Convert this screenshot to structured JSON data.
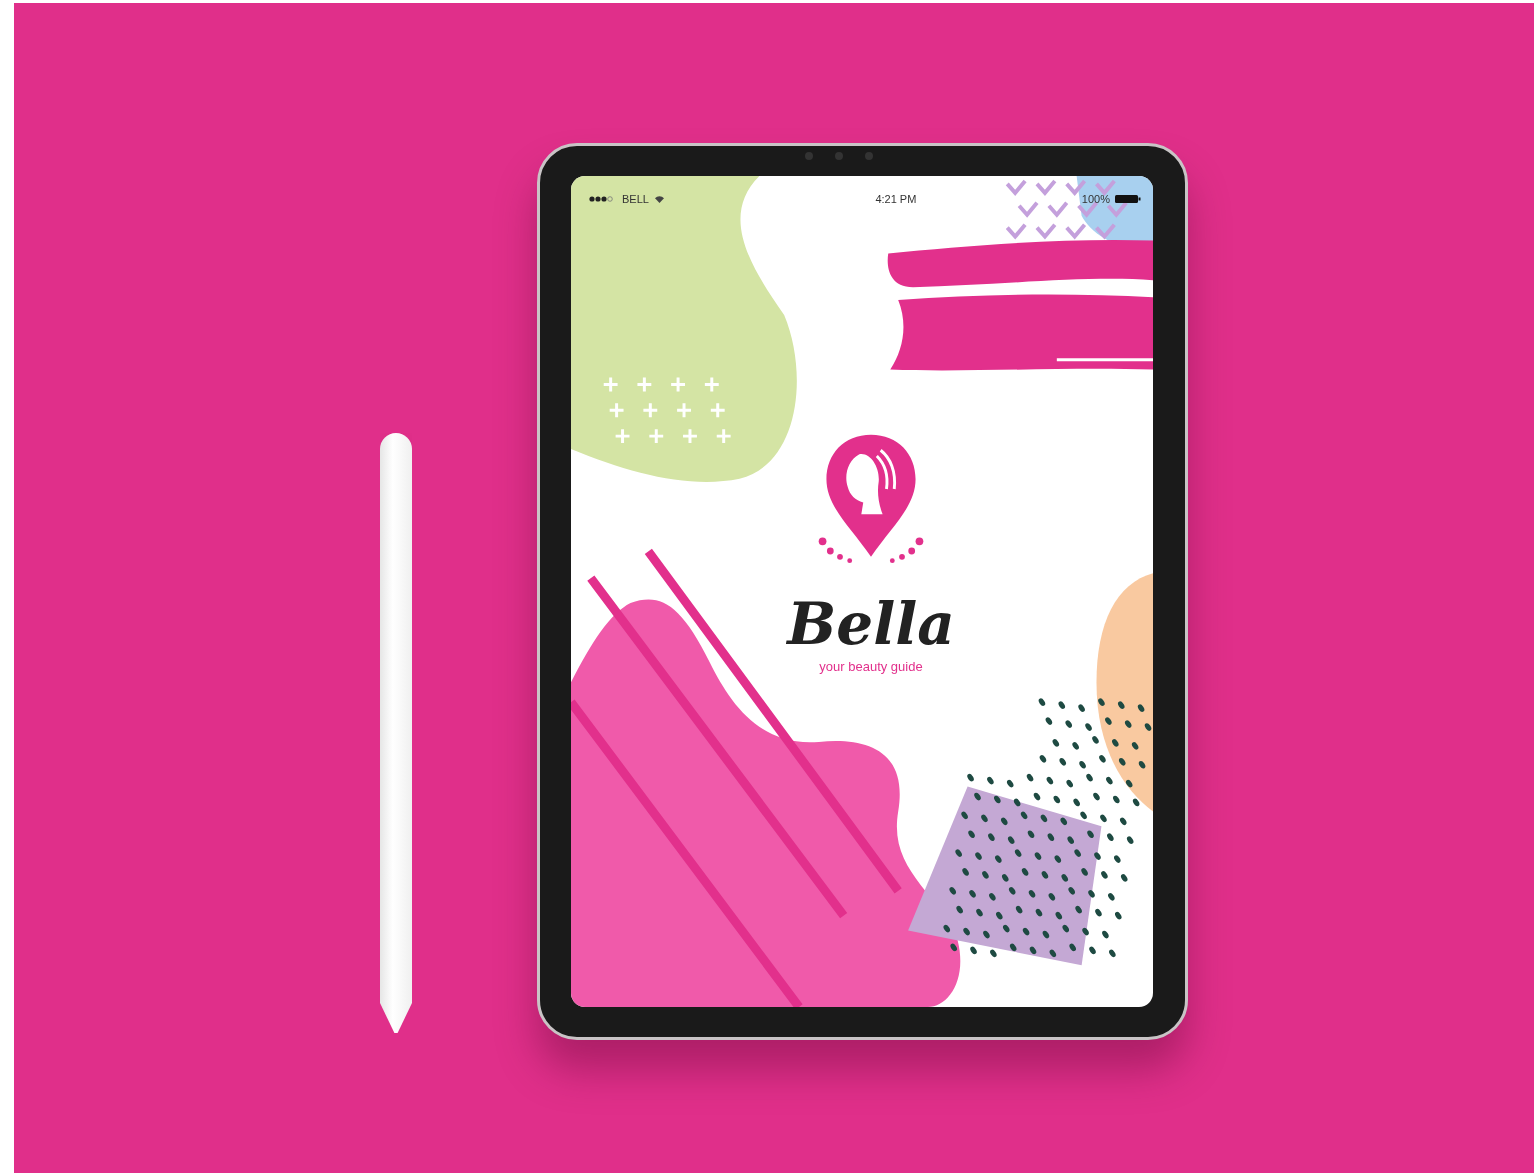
{
  "status_bar": {
    "carrier": "BELL",
    "time": "4:21 PM",
    "battery": "100%"
  },
  "app": {
    "name": "Bella",
    "tagline": "your beauty guide"
  }
}
